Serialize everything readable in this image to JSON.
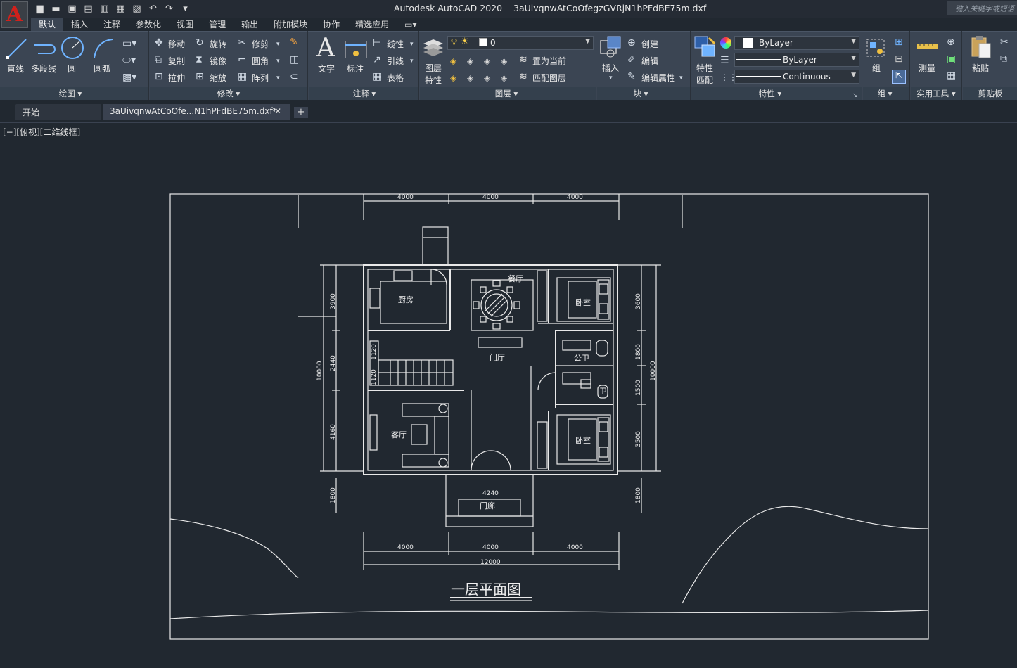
{
  "app": {
    "title": "Autodesk AutoCAD 2020",
    "filename": "3aUivqnwAtCoOfegzGVRjN1hPFdBE75m.dxf",
    "logo_letter": "A",
    "search_placeholder": "键入关键字或短语"
  },
  "menu_tabs": [
    "默认",
    "插入",
    "注释",
    "参数化",
    "视图",
    "管理",
    "输出",
    "附加模块",
    "协作",
    "精选应用"
  ],
  "ribbon": {
    "draw": {
      "title": "绘图",
      "line": "直线",
      "polyline": "多段线",
      "circle": "圆",
      "arc": "圆弧"
    },
    "modify": {
      "title": "修改",
      "move": "移动",
      "rotate": "旋转",
      "trim": "修剪",
      "copy": "复制",
      "mirror": "镜像",
      "fillet": "圆角",
      "stretch": "拉伸",
      "scale": "缩放",
      "array": "阵列"
    },
    "annotation": {
      "title": "注释",
      "text": "文字",
      "dimension": "标注",
      "linear": "线性",
      "leader": "引线",
      "table": "表格"
    },
    "layers": {
      "title": "图层",
      "properties_line1": "图层",
      "properties_line2": "特性",
      "current_layer": "0",
      "make_current": "置为当前",
      "match_layer": "匹配图层"
    },
    "block": {
      "title": "块",
      "insert": "插入",
      "create": "创建",
      "edit": "编辑",
      "edit_attributes": "编辑属性"
    },
    "properties": {
      "title": "特性",
      "match_line1": "特性",
      "match_line2": "匹配",
      "color": "ByLayer",
      "lineweight": "ByLayer",
      "linetype": "Continuous"
    },
    "groups": {
      "title": "组",
      "group": "组"
    },
    "utilities": {
      "title": "实用工具",
      "measure": "测量"
    },
    "clipboard": {
      "title": "剪贴板",
      "paste": "粘贴"
    }
  },
  "file_tabs": {
    "start": "开始",
    "current": "3aUivqnwAtCoOfe...N1hPFdBE75m.dxf*"
  },
  "viewport_label": "[−][俯视][二维线框]",
  "drawing": {
    "title": "一层平面图",
    "rooms": {
      "kitchen": "厨房",
      "dining": "餐厅",
      "bedroom1": "卧室",
      "public_wc": "公卫",
      "foyer": "门厅",
      "living": "客厅",
      "bathroom": "卫",
      "bedroom2": "卧室",
      "entrance": "门廊"
    },
    "dims_top": [
      "4000",
      "4000",
      "4000"
    ],
    "dims_bottom": [
      "4000",
      "4000",
      "4000"
    ],
    "dim_total_bottom": "12000",
    "dim_porch": "4240",
    "dims_left": [
      "3900",
      "2440",
      "4160"
    ],
    "dim_left_total": "10000",
    "dim_left_porch": "1800",
    "dims_right": [
      "3600",
      "1800",
      "1500",
      "3500"
    ],
    "dim_right_total": "10000",
    "dim_right_porch": "1800",
    "dims_stair": [
      "1120",
      "1120"
    ]
  }
}
